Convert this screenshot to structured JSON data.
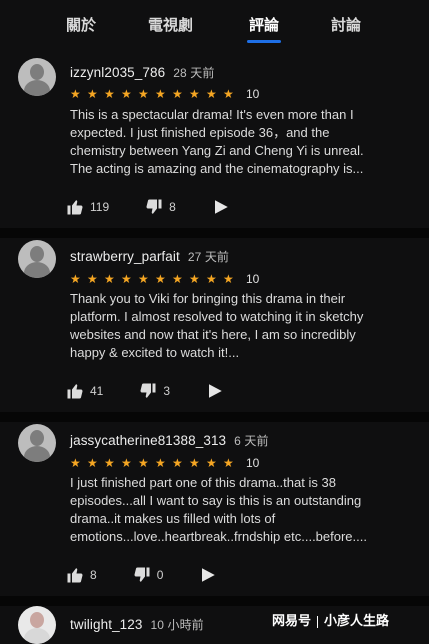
{
  "tabs": [
    "關於",
    "電視劇",
    "評論",
    "討論"
  ],
  "accent": "#1e6fe6",
  "star_color": "#f5a623",
  "reviews": [
    {
      "user": "izzynl2035_786",
      "age": "28 天前",
      "rating": "10",
      "text_lines": [
        "This is a spectacular drama! It's even more than I",
        "expected. I just finished episode 36，and the",
        "chemistry between Yang Zi and Cheng Yi is unreal.",
        "The acting is amazing and the cinematography is..."
      ],
      "likes": "119",
      "dislikes": "8"
    },
    {
      "user": "strawberry_parfait",
      "age": "27 天前",
      "rating": "10",
      "text_lines": [
        "Thank you to Viki for bringing this drama in their",
        "platform. I almost resolved to watching it in sketchy",
        "websites and now that it's here, I am so incredibly",
        "happy & excited to watch it!..."
      ],
      "likes": "41",
      "dislikes": "3"
    },
    {
      "user": "jassycatherine81388_313",
      "age": "6 天前",
      "rating": "10",
      "text_lines": [
        "I just finished part one of this drama..that is 38",
        "episodes...all I want to say is this is an outstanding",
        "drama..it makes us filled with lots of",
        "emotions...love..heartbreak..frndship etc....before...."
      ],
      "likes": "8",
      "dislikes": "0"
    },
    {
      "user": "twilight_123",
      "age": "10 小時前"
    }
  ],
  "watermark": {
    "left": "网易号",
    "right": "小彦人生路"
  },
  "icons": [
    "thumbs-up-icon",
    "thumbs-down-icon",
    "share-icon",
    "star-icon",
    "avatar-placeholder"
  ]
}
